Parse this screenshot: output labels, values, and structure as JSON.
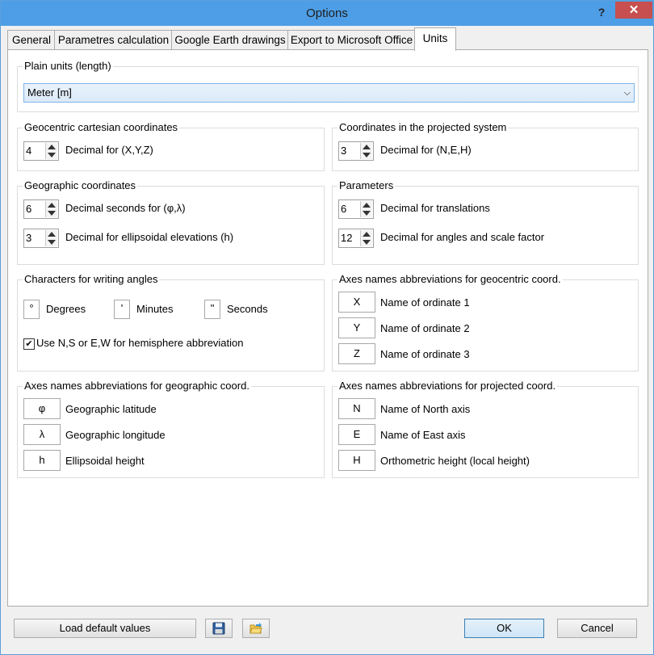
{
  "window": {
    "title": "Options",
    "help": "?",
    "close": "✕"
  },
  "tabs": [
    {
      "label": "General"
    },
    {
      "label": "Parametres calculation"
    },
    {
      "label": "Google Earth drawings"
    },
    {
      "label": "Export to Microsoft Office"
    },
    {
      "label": "Units"
    }
  ],
  "plain_units": {
    "title": "Plain units (length)",
    "selected": "Meter [m]"
  },
  "geocentric": {
    "title": "Geocentric cartesian coordinates",
    "value": "4",
    "label": "Decimal for (X,Y,Z)"
  },
  "projected": {
    "title": "Coordinates in the projected system",
    "value": "3",
    "label": "Decimal for (N,E,H)"
  },
  "geographic": {
    "title": "Geographic coordinates",
    "seconds_value": "6",
    "seconds_label": "Decimal seconds for (φ,λ)",
    "elev_value": "3",
    "elev_label": "Decimal for ellipsoidal elevations (h)"
  },
  "parameters": {
    "title": "Parameters",
    "trans_value": "6",
    "trans_label": "Decimal for translations",
    "angles_value": "12",
    "angles_label": "Decimal for angles and scale factor"
  },
  "angles_chars": {
    "title": "Characters for writing angles",
    "degrees_char": "°",
    "degrees_label": "Degrees",
    "minutes_char": "'",
    "minutes_label": "Minutes",
    "seconds_char": "\"",
    "seconds_label": "Seconds",
    "hemisphere_label": "Use N,S or E,W for hemisphere abbreviation",
    "hemisphere_checked": "✔"
  },
  "geocentric_axes": {
    "title": "Axes names abbreviations for geocentric coord.",
    "items": [
      {
        "abbr": "X",
        "label": "Name of ordinate 1"
      },
      {
        "abbr": "Y",
        "label": "Name of ordinate 2"
      },
      {
        "abbr": "Z",
        "label": "Name of ordinate 3"
      }
    ]
  },
  "geographic_axes": {
    "title": "Axes names abbreviations for geographic coord.",
    "items": [
      {
        "abbr": "φ",
        "label": "Geographic latitude"
      },
      {
        "abbr": "λ",
        "label": "Geographic longitude"
      },
      {
        "abbr": "h",
        "label": "Ellipsoidal height"
      }
    ]
  },
  "projected_axes": {
    "title": "Axes names abbreviations for projected coord.",
    "items": [
      {
        "abbr": "N",
        "label": "Name of North axis"
      },
      {
        "abbr": "E",
        "label": "Name of East axis"
      },
      {
        "abbr": "H",
        "label": "Orthometric height (local height)"
      }
    ]
  },
  "buttons": {
    "load_defaults": "Load default values",
    "ok": "OK",
    "cancel": "Cancel"
  },
  "icons": {
    "save": "save-icon",
    "open": "open-folder-icon"
  }
}
